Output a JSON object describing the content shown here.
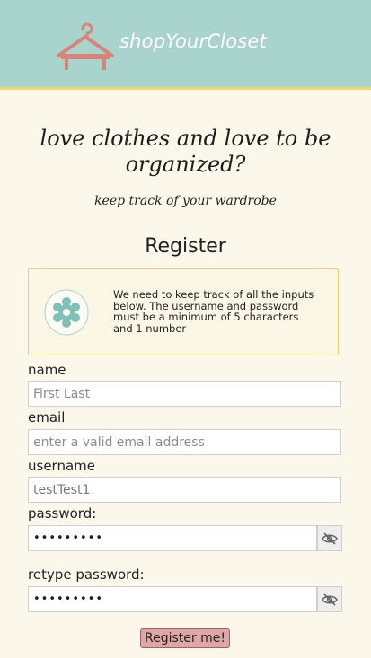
{
  "header": {
    "brand": "shopYourCloset",
    "logo_icon": "hanger-icon"
  },
  "hero": {
    "line1": "love clothes and love to be",
    "line2": "organized?",
    "subtitle": "keep track of your wardrobe"
  },
  "form": {
    "title": "Register",
    "info_icon": "gear-flower-icon",
    "info_text": "We need to keep track of all the inputs below. The username and password must be a minimum of 5 characters and 1 number",
    "name_label": "name",
    "name_placeholder": "First Last",
    "email_label": "email",
    "email_placeholder": "enter a valid email address",
    "username_label": "username",
    "username_value": "testTest1",
    "password_label": "password:",
    "password_value": "•••••••••",
    "retype_label": "retype password:",
    "retype_value": "•••••••••",
    "toggle_icon": "eye-slash-icon",
    "submit_label": "Register me!"
  },
  "colors": {
    "header_bg": "#a9d3cd",
    "accent_border": "#f3d36b",
    "page_bg": "#fbf7ea",
    "logo": "#d8847a",
    "button_bg": "#dea6a6"
  }
}
